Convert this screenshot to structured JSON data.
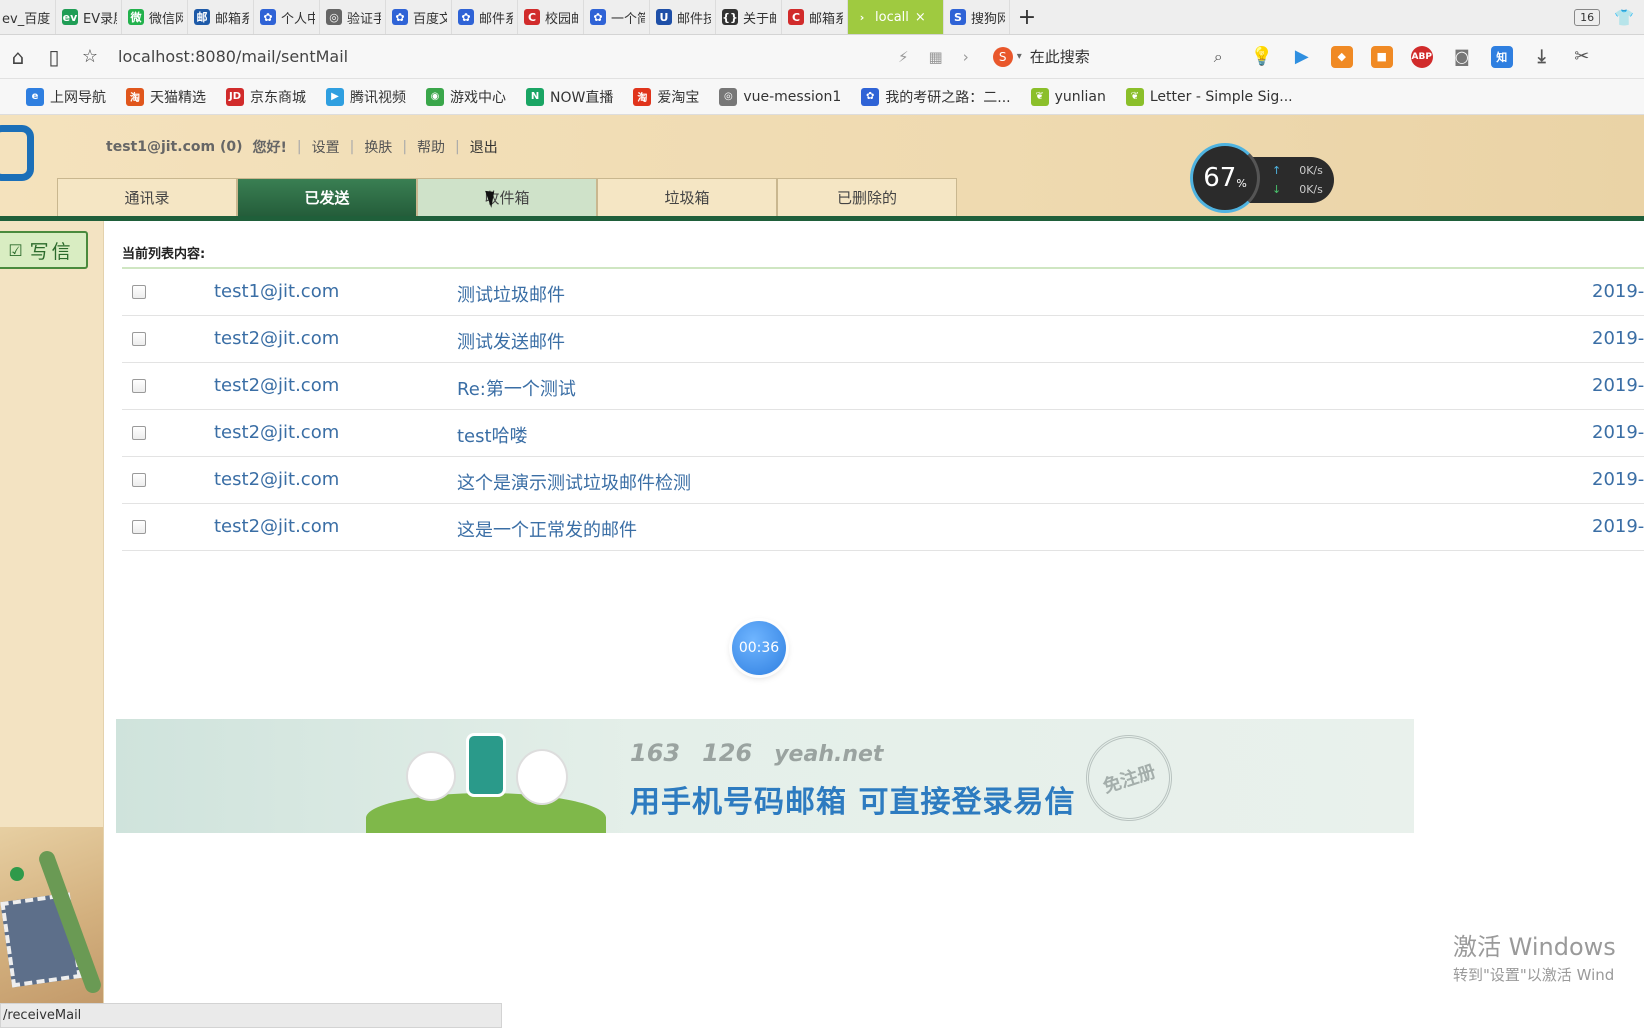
{
  "browser": {
    "tabs": [
      {
        "label": "ev_百度",
        "icon_color": "#777777",
        "icon_glyph": ""
      },
      {
        "label": "EV录屏",
        "icon_color": "#1f9d55",
        "icon_glyph": "ev"
      },
      {
        "label": "微信网",
        "icon_color": "#22b14c",
        "icon_glyph": "微"
      },
      {
        "label": "邮箱系",
        "icon_color": "#1e5aa8",
        "icon_glyph": "邮"
      },
      {
        "label": "个人中",
        "icon_color": "#2f63d6",
        "icon_glyph": "✿"
      },
      {
        "label": "验证手",
        "icon_color": "#666666",
        "icon_glyph": "◎"
      },
      {
        "label": "百度文",
        "icon_color": "#2f63d6",
        "icon_glyph": "✿"
      },
      {
        "label": "邮件系",
        "icon_color": "#2f63d6",
        "icon_glyph": "✿"
      },
      {
        "label": "校园邮",
        "icon_color": "#d12b2b",
        "icon_glyph": "C"
      },
      {
        "label": "一个简",
        "icon_color": "#2f63d6",
        "icon_glyph": "✿"
      },
      {
        "label": "邮件技",
        "icon_color": "#1e4fa8",
        "icon_glyph": "U"
      },
      {
        "label": "关于邮",
        "icon_color": "#333333",
        "icon_glyph": "{}"
      },
      {
        "label": "邮箱系",
        "icon_color": "#d12b2b",
        "icon_glyph": "C"
      },
      {
        "label": "locall",
        "icon_color": "#9fca40",
        "icon_glyph": "›",
        "active": true
      },
      {
        "label": "搜狗网",
        "icon_color": "#2f63d6",
        "icon_glyph": "S"
      }
    ],
    "new_tab_label": "+",
    "tab_count": "16",
    "url": "localhost:8080/mail/sentMail",
    "search_placeholder": "在此搜索",
    "bookmarks": [
      {
        "label": "上网导航",
        "icon_color": "#2f7fe0",
        "glyph": "e"
      },
      {
        "label": "天猫精选",
        "icon_color": "#e0561c",
        "glyph": "淘"
      },
      {
        "label": "京东商城",
        "icon_color": "#d12b2b",
        "glyph": "JD"
      },
      {
        "label": "腾讯视频",
        "icon_color": "#2f9fe0",
        "glyph": "▶"
      },
      {
        "label": "游戏中心",
        "icon_color": "#3aa64a",
        "glyph": "◉"
      },
      {
        "label": "NOW直播",
        "icon_color": "#1aa564",
        "glyph": "N"
      },
      {
        "label": "爱淘宝",
        "icon_color": "#e0341c",
        "glyph": "淘"
      },
      {
        "label": "vue-mession1",
        "icon_color": "#777777",
        "glyph": "◎"
      },
      {
        "label": "我的考研之路：二...",
        "icon_color": "#2f63d6",
        "glyph": "✿"
      },
      {
        "label": "yunlian",
        "icon_color": "#8bbf2a",
        "glyph": "❦"
      },
      {
        "label": "Letter - Simple Sig...",
        "icon_color": "#8bbf2a",
        "glyph": "❦"
      }
    ]
  },
  "header": {
    "user": "test1@jit.com (0)",
    "greeting": "您好!",
    "links": [
      "设置",
      "换肤",
      "帮助"
    ],
    "logout": "退出",
    "tabs": [
      {
        "label": "通讯录"
      },
      {
        "label": "已发送",
        "active": true
      },
      {
        "label": "收件箱",
        "hover": true
      },
      {
        "label": "垃圾箱"
      },
      {
        "label": "已删除的"
      }
    ],
    "speed": {
      "percent": "67",
      "percent_unit": "%",
      "upload": "0K/s",
      "download": "0K/s"
    }
  },
  "sidebar": {
    "write_label": "写信"
  },
  "main": {
    "list_title": "当前列表内容:",
    "rows": [
      {
        "sender": "test1@jit.com",
        "subject": "测试垃圾邮件",
        "date": "2019-"
      },
      {
        "sender": "test2@jit.com",
        "subject": "测试发送邮件",
        "date": "2019-"
      },
      {
        "sender": "test2@jit.com",
        "subject": "Re:第一个测试",
        "date": "2019-"
      },
      {
        "sender": "test2@jit.com",
        "subject": "test哈喽",
        "date": "2019-"
      },
      {
        "sender": "test2@jit.com",
        "subject": "这个是演示测试垃圾邮件检测",
        "date": "2019-"
      },
      {
        "sender": "test2@jit.com",
        "subject": "这是一个正常发的邮件",
        "date": "2019-"
      }
    ],
    "timer": "00:36"
  },
  "banner": {
    "brand1": "163",
    "brand2": "126",
    "brand3": "yeah.net",
    "slogan": "用手机号码邮箱  可直接登录易信",
    "seal": "免注册"
  },
  "watermark": {
    "line1": "激活 Windows",
    "line2": "转到\"设置\"以激活 Wind"
  },
  "statusbar": {
    "text": "/receiveMail"
  }
}
